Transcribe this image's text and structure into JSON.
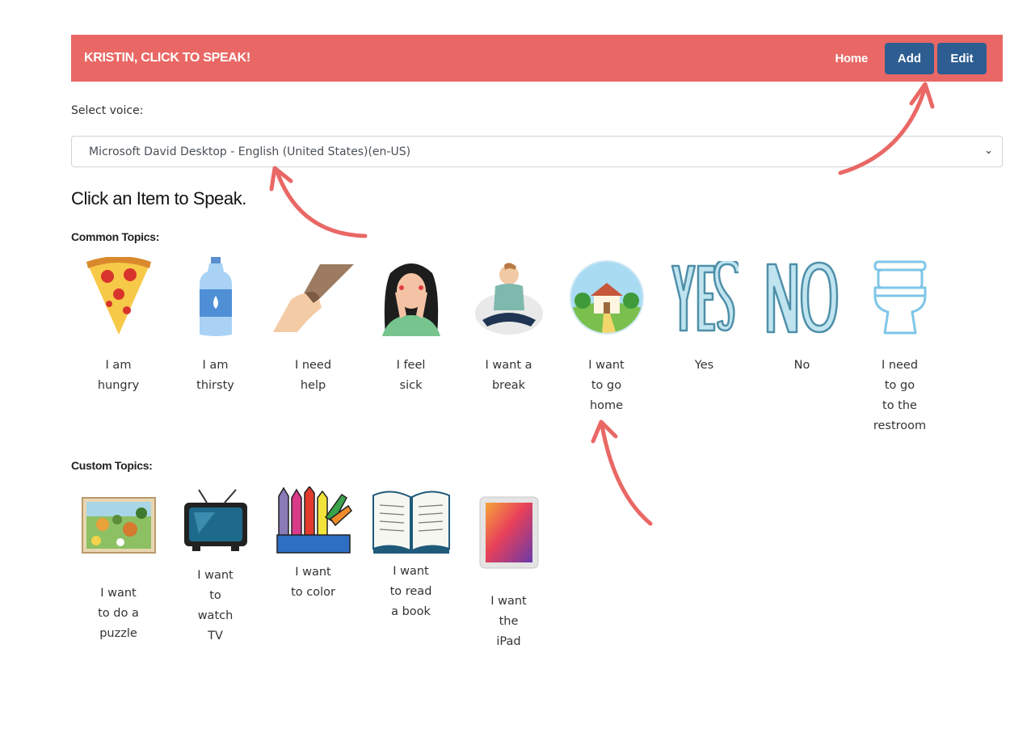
{
  "navbar": {
    "brand": "KRISTIN, CLICK TO SPEAK!",
    "home_label": "Home",
    "add_label": "Add",
    "edit_label": "Edit"
  },
  "voice": {
    "label": "Select voice:",
    "selected": "Microsoft David Desktop - English (United States)(en-US)"
  },
  "heading": "Click an Item to Speak.",
  "common": {
    "label": "Common Topics:",
    "items": [
      {
        "icon": "pizza-icon",
        "lines": [
          "I am",
          "hungry"
        ]
      },
      {
        "icon": "water-bottle-icon",
        "lines": [
          "I am",
          "thirsty"
        ]
      },
      {
        "icon": "helping-hands-icon",
        "lines": [
          "I need",
          "help"
        ]
      },
      {
        "icon": "sick-person-icon",
        "lines": [
          "I feel",
          "sick"
        ]
      },
      {
        "icon": "meditating-person-icon",
        "lines": [
          "I want a",
          "break"
        ]
      },
      {
        "icon": "home-icon",
        "lines": [
          "I want",
          "to go",
          "home"
        ]
      },
      {
        "icon": "yes-icon",
        "lines": [
          "Yes"
        ]
      },
      {
        "icon": "no-icon",
        "lines": [
          "No"
        ]
      },
      {
        "icon": "toilet-icon",
        "lines": [
          "I need",
          "to go",
          "to the",
          "restroom"
        ]
      }
    ]
  },
  "custom": {
    "label": "Custom Topics:",
    "items": [
      {
        "icon": "puzzle-icon",
        "lines": [
          "I want",
          "to do a",
          "puzzle"
        ]
      },
      {
        "icon": "tv-icon",
        "lines": [
          "I want",
          "to",
          "watch",
          "TV"
        ]
      },
      {
        "icon": "crayons-icon",
        "lines": [
          "I want",
          "to color"
        ]
      },
      {
        "icon": "book-icon",
        "lines": [
          "I want",
          "to read",
          "a book"
        ]
      },
      {
        "icon": "ipad-icon",
        "lines": [
          "I want",
          "the",
          "iPad"
        ]
      }
    ]
  }
}
